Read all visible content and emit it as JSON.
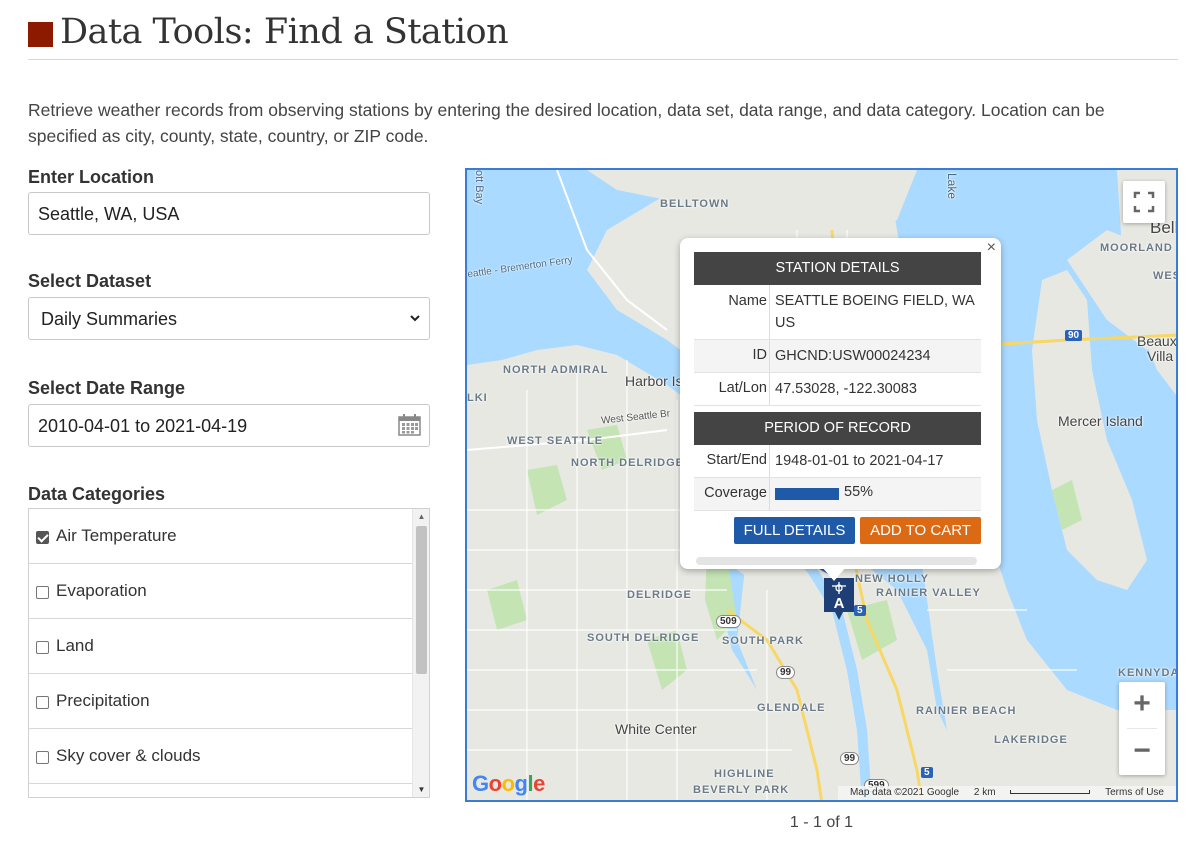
{
  "page": {
    "title": "Data Tools: Find a Station",
    "intro": "Retrieve weather records from observing stations by entering the desired location, data set, data range, and data category. Location can be specified as city, county, state, country, or ZIP code."
  },
  "location": {
    "label": "Enter Location",
    "value": "Seattle, WA, USA"
  },
  "dataset": {
    "label": "Select Dataset",
    "selected": "Daily Summaries"
  },
  "date_range": {
    "label": "Select Date Range",
    "value": "2010-04-01 to 2021-04-19"
  },
  "categories": {
    "label": "Data Categories",
    "items": [
      {
        "label": "Air Temperature",
        "checked": true
      },
      {
        "label": "Evaporation",
        "checked": false
      },
      {
        "label": "Land",
        "checked": false
      },
      {
        "label": "Precipitation",
        "checked": false
      },
      {
        "label": "Sky cover & clouds",
        "checked": false
      }
    ]
  },
  "map": {
    "labels": {
      "belltown": "BELLTOWN",
      "seattle_bremerton": "eattle - Bremerton Ferry",
      "north_admiral": "NORTH ADMIRAL",
      "harbor_island": "Harbor Is",
      "west_seattle_bridge": "West Seattle Br",
      "west_seattle": "WEST SEATTLE",
      "north_delridge": "NORTH DELRIDGE",
      "delridge": "DELRIDGE",
      "south_delridge": "SOUTH DELRIDGE",
      "south_park": "SOUTH PARK",
      "white_center": "White Center",
      "glendale": "GLENDALE",
      "highline": "HIGHLINE",
      "beverly_park": "BEVERLY PARK",
      "new_holly": "NEW HOLLY",
      "rainier_valley": "RAINIER VALLEY",
      "rainier_beach": "RAINIER BEACH",
      "lakeridge": "LAKERIDGE",
      "kennydale": "KENNYDA",
      "mercer_island": "Mercer Island",
      "beaux_arts": "Beaux",
      "beaux_arts2": "Villa",
      "moorland": "MOORLAND",
      "west": "WEST",
      "bellevue": "Belle",
      "lake": "Lake",
      "elliott_bay": "ott Bay",
      "alki": "LKI",
      "route_509": "509",
      "route_99a": "99",
      "route_99b": "99",
      "route_599": "599",
      "route_5a": "5",
      "route_5b": "5",
      "route_90": "90"
    },
    "attribution": {
      "data": "Map data ©2021 Google",
      "scale": "2 km",
      "terms": "Terms of Use"
    },
    "logo": "Google"
  },
  "popup": {
    "station_header": "STATION DETAILS",
    "name_key": "Name",
    "name_value": "SEATTLE BOEING FIELD, WA US",
    "id_key": "ID",
    "id_value": "GHCND:USW00024234",
    "latlon_key": "Lat/Lon",
    "latlon_value": "47.53028, -122.30083",
    "period_header": "PERIOD OF RECORD",
    "startend_key": "Start/End",
    "startend_value": "1948-01-01 to 2021-04-17",
    "coverage_key": "Coverage",
    "coverage_pct": "55%",
    "coverage_fraction": 0.55,
    "details_button": "FULL DETAILS",
    "cart_button": "ADD TO CART",
    "close": "×"
  },
  "marker_letter": "A",
  "pager": "1 - 1 of 1",
  "colors": {
    "accent_square": "#8b1a00",
    "details_button": "#1e5aa8",
    "cart_button": "#dc6a14",
    "coverage_bar": "#1e5aa8",
    "map_border": "#3a7bd5"
  }
}
